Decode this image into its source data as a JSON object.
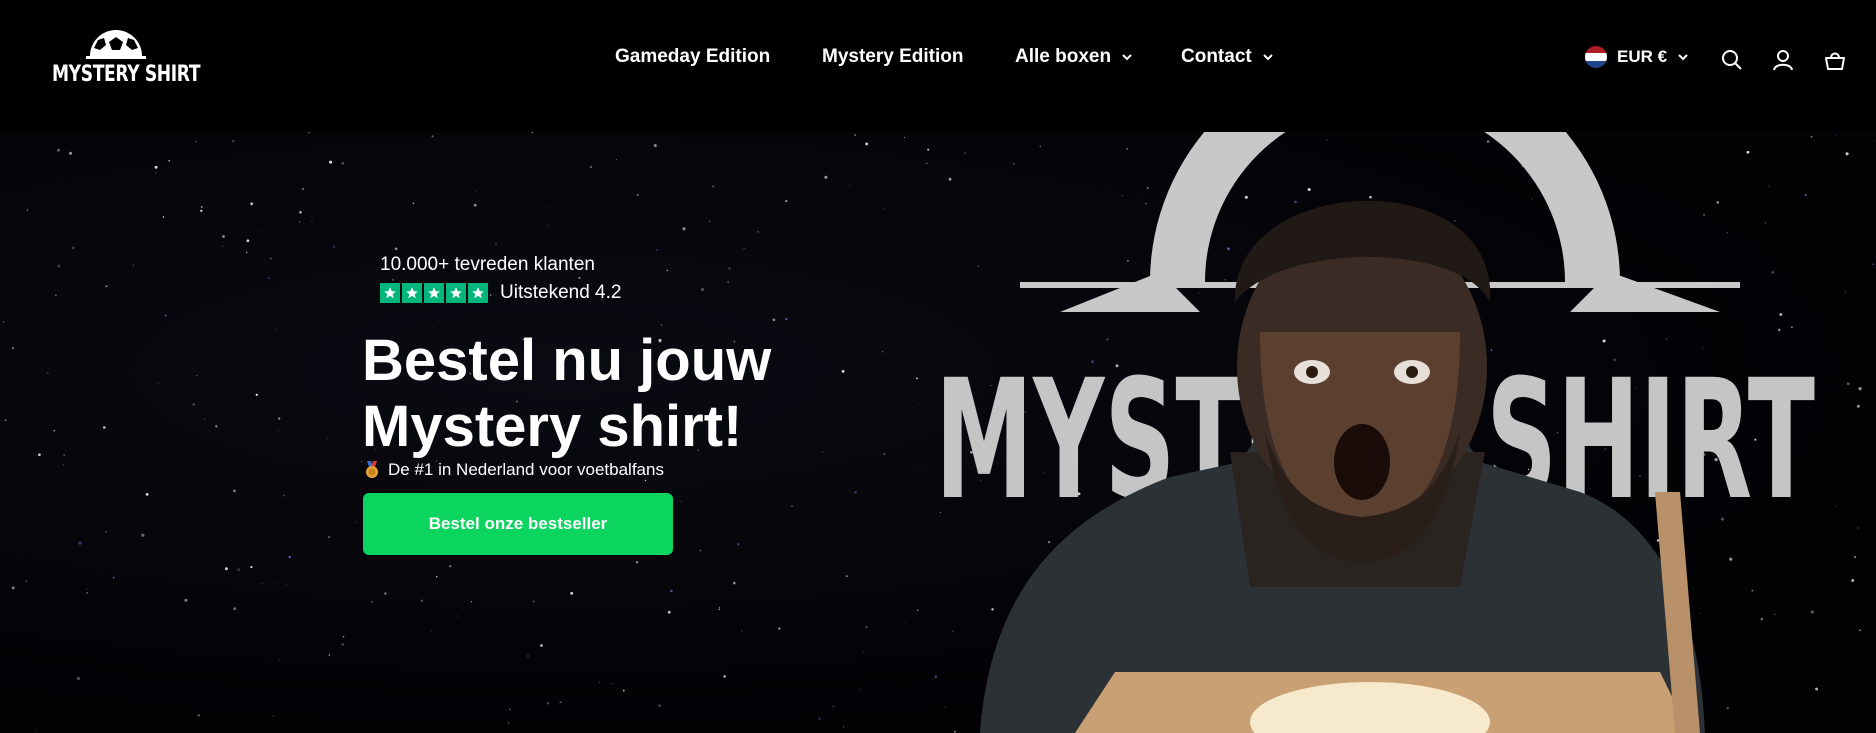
{
  "header": {
    "logo_text": "MYSTERY SHIRT",
    "nav": [
      {
        "label": "Gameday Edition",
        "has_dropdown": false
      },
      {
        "label": "Mystery Edition",
        "has_dropdown": false
      },
      {
        "label": "Alle boxen",
        "has_dropdown": true
      },
      {
        "label": "Contact",
        "has_dropdown": true
      }
    ],
    "currency": {
      "label": "EUR €",
      "flag_colors": [
        "#ae1c28",
        "#ffffff",
        "#21468b"
      ],
      "icon": "chevron-down-icon"
    },
    "tools": [
      {
        "name": "search-icon"
      },
      {
        "name": "account-icon"
      },
      {
        "name": "cart-icon"
      }
    ]
  },
  "hero": {
    "social_proof": "10.000+ tevreden klanten",
    "rating_label": "Uitstekend 4.2",
    "rating_stars": 5,
    "rating_color": "#00b67a",
    "headline_line1": "Bestel nu jouw",
    "headline_line2": "Mystery shirt!",
    "subline": "De #1 in Nederland voor voetbalfans",
    "subline_icon": "medal-icon",
    "cta_label": "Bestel onze bestseller",
    "cta_color": "#0bd45f",
    "background_logo_text": "MYSTERY SHIRT"
  }
}
